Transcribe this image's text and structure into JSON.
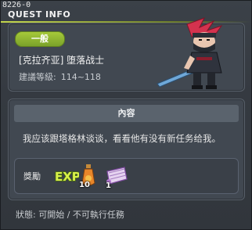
{
  "window": {
    "id_label": "8226-0",
    "title": "QUEST INFO"
  },
  "quest": {
    "category_badge": "一般",
    "name": "[克拉齐亚] 堕落战士",
    "level_label": "建議等級:",
    "level_range": "114~118"
  },
  "content": {
    "header": "內容",
    "text": "我应该跟塔格林谈谈，看看他有没有新任务给我。"
  },
  "rewards": {
    "label": "獎勵",
    "items": [
      {
        "icon": "exp-icon",
        "text": "EXP"
      },
      {
        "icon": "potion-icon",
        "count": "10"
      },
      {
        "icon": "scroll-icon",
        "count": "1"
      }
    ]
  },
  "status": {
    "text": "狀態: 可開始 / 不可執行任務"
  },
  "colors": {
    "background": "#353a41",
    "panel": "#414851",
    "badge_green": "#8db532",
    "title_underline": "#c3d64c"
  }
}
